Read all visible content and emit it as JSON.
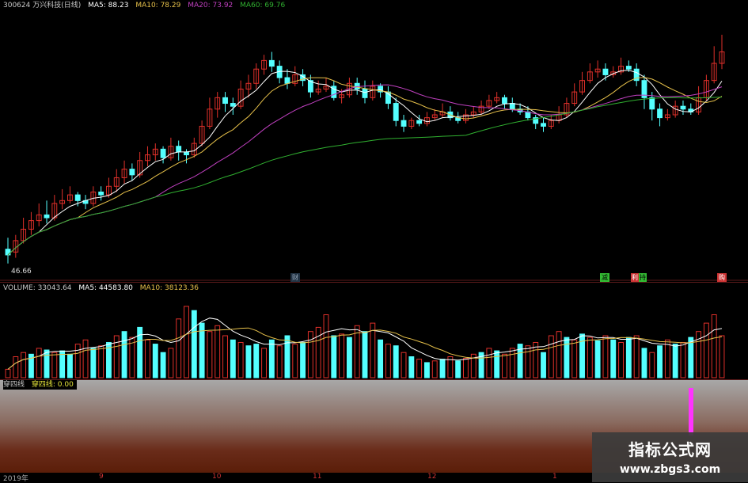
{
  "price_header": {
    "symbol": "300624 万兴科技(日线)",
    "ma5": "MA5: 88.23",
    "ma10": "MA10: 78.29",
    "ma20": "MA20: 73.92",
    "ma60": "MA60: 69.76"
  },
  "price_low_label": "46.66",
  "event_markers": [
    "财",
    "减",
    "利",
    "持",
    "购"
  ],
  "volume_header": {
    "volume": "VOLUME: 33043.64",
    "ma5": "MA5: 44583.80",
    "ma10": "MA10: 38123.36"
  },
  "indicator_header": {
    "name": "穿四线",
    "value": "穿四线: 0.00"
  },
  "time_axis": [
    "2019年",
    "9",
    "10",
    "11",
    "12",
    "1"
  ],
  "watermark": {
    "title": "指标公式网",
    "url": "www.zbgs3.com"
  },
  "colors": {
    "up": "#e0302a",
    "down": "#54ffff",
    "ma5": "#ffffff",
    "ma10": "#e6c04a",
    "ma20": "#c040c0",
    "ma60": "#30b030",
    "indicator_bar": "#ff33ff"
  },
  "candles": [
    [
      27,
      25,
      31,
      22
    ],
    [
      26,
      30,
      32,
      24
    ],
    [
      30,
      34,
      38,
      29
    ],
    [
      34,
      37,
      40,
      32
    ],
    [
      37,
      39,
      43,
      35
    ],
    [
      39,
      38,
      44,
      36
    ],
    [
      38,
      43,
      46,
      37
    ],
    [
      43,
      44,
      48,
      41
    ],
    [
      44,
      46,
      49,
      43
    ],
    [
      46,
      44,
      47,
      42
    ],
    [
      44,
      43,
      46,
      41
    ],
    [
      43,
      47,
      49,
      42
    ],
    [
      47,
      46,
      49,
      44
    ],
    [
      46,
      49,
      52,
      45
    ],
    [
      49,
      52,
      55,
      47
    ],
    [
      52,
      55,
      58,
      50
    ],
    [
      55,
      53,
      57,
      51
    ],
    [
      53,
      58,
      61,
      52
    ],
    [
      58,
      60,
      63,
      56
    ],
    [
      60,
      62,
      64,
      58
    ],
    [
      62,
      59,
      63,
      57
    ],
    [
      59,
      63,
      66,
      58
    ],
    [
      63,
      61,
      65,
      58
    ],
    [
      61,
      60,
      62,
      57
    ],
    [
      60,
      64,
      66,
      59
    ],
    [
      64,
      70,
      72,
      63
    ],
    [
      70,
      76,
      80,
      69
    ],
    [
      76,
      80,
      82,
      73
    ],
    [
      80,
      78,
      82,
      75
    ],
    [
      78,
      77,
      80,
      74
    ],
    [
      77,
      83,
      86,
      76
    ],
    [
      83,
      85,
      88,
      80
    ],
    [
      85,
      90,
      92,
      83
    ],
    [
      90,
      93,
      95,
      88
    ],
    [
      93,
      91,
      96,
      89
    ],
    [
      91,
      87,
      93,
      85
    ],
    [
      87,
      85,
      90,
      83
    ],
    [
      85,
      88,
      91,
      84
    ],
    [
      88,
      86,
      90,
      84
    ],
    [
      86,
      82,
      88,
      80
    ],
    [
      82,
      83,
      86,
      81
    ],
    [
      83,
      84,
      87,
      82
    ],
    [
      84,
      80,
      86,
      79
    ],
    [
      80,
      81,
      83,
      78
    ],
    [
      81,
      85,
      87,
      80
    ],
    [
      85,
      83,
      87,
      81
    ],
    [
      83,
      80,
      86,
      78
    ],
    [
      80,
      84,
      86,
      79
    ],
    [
      84,
      82,
      85,
      80
    ],
    [
      82,
      78,
      84,
      76
    ],
    [
      78,
      72,
      80,
      70
    ],
    [
      72,
      70,
      74,
      68
    ],
    [
      70,
      72,
      73,
      69
    ],
    [
      72,
      71,
      74,
      70
    ],
    [
      71,
      73,
      75,
      70
    ],
    [
      73,
      74,
      76,
      72
    ],
    [
      74,
      75,
      78,
      73
    ],
    [
      75,
      73,
      77,
      72
    ],
    [
      73,
      72,
      75,
      71
    ],
    [
      72,
      74,
      76,
      71
    ],
    [
      74,
      75,
      77,
      73
    ],
    [
      75,
      77,
      79,
      74
    ],
    [
      77,
      79,
      81,
      76
    ],
    [
      79,
      80,
      82,
      78
    ],
    [
      80,
      78,
      81,
      76
    ],
    [
      78,
      76,
      80,
      75
    ],
    [
      76,
      75,
      78,
      74
    ],
    [
      75,
      73,
      77,
      72
    ],
    [
      73,
      71,
      74,
      69
    ],
    [
      71,
      70,
      73,
      68
    ],
    [
      70,
      72,
      74,
      69
    ],
    [
      72,
      74,
      77,
      71
    ],
    [
      74,
      78,
      80,
      73
    ],
    [
      78,
      82,
      85,
      77
    ],
    [
      82,
      86,
      89,
      81
    ],
    [
      86,
      89,
      92,
      85
    ],
    [
      89,
      90,
      93,
      87
    ],
    [
      90,
      88,
      92,
      86
    ],
    [
      88,
      89,
      91,
      87
    ],
    [
      89,
      91,
      94,
      88
    ],
    [
      91,
      90,
      93,
      89
    ],
    [
      90,
      86,
      92,
      84
    ],
    [
      86,
      80,
      88,
      76
    ],
    [
      80,
      76,
      82,
      72
    ],
    [
      76,
      73,
      78,
      70
    ],
    [
      73,
      74,
      76,
      72
    ],
    [
      74,
      77,
      79,
      73
    ],
    [
      77,
      76,
      79,
      74
    ],
    [
      76,
      75,
      78,
      74
    ],
    [
      75,
      80,
      84,
      74
    ],
    [
      80,
      86,
      88,
      79
    ],
    [
      86,
      92,
      98,
      85
    ],
    [
      92,
      96,
      102,
      90
    ]
  ],
  "volumes": [
    [
      0.1,
      1
    ],
    [
      0.25,
      1
    ],
    [
      0.3,
      1
    ],
    [
      0.28,
      0
    ],
    [
      0.35,
      1
    ],
    [
      0.33,
      0
    ],
    [
      0.3,
      1
    ],
    [
      0.32,
      0
    ],
    [
      0.28,
      0
    ],
    [
      0.4,
      1
    ],
    [
      0.45,
      1
    ],
    [
      0.35,
      0
    ],
    [
      0.38,
      1
    ],
    [
      0.42,
      0
    ],
    [
      0.5,
      1
    ],
    [
      0.55,
      0
    ],
    [
      0.48,
      1
    ],
    [
      0.6,
      0
    ],
    [
      0.45,
      1
    ],
    [
      0.4,
      0
    ],
    [
      0.3,
      0
    ],
    [
      0.35,
      1
    ],
    [
      0.7,
      1
    ],
    [
      0.85,
      1
    ],
    [
      0.8,
      0
    ],
    [
      0.65,
      0
    ],
    [
      0.55,
      1
    ],
    [
      0.62,
      1
    ],
    [
      0.5,
      1
    ],
    [
      0.45,
      0
    ],
    [
      0.42,
      1
    ],
    [
      0.38,
      0
    ],
    [
      0.4,
      0
    ],
    [
      0.35,
      1
    ],
    [
      0.45,
      0
    ],
    [
      0.38,
      1
    ],
    [
      0.5,
      0
    ],
    [
      0.4,
      1
    ],
    [
      0.42,
      0
    ],
    [
      0.55,
      1
    ],
    [
      0.6,
      1
    ],
    [
      0.75,
      1
    ],
    [
      0.5,
      0
    ],
    [
      0.52,
      1
    ],
    [
      0.48,
      0
    ],
    [
      0.62,
      1
    ],
    [
      0.55,
      0
    ],
    [
      0.65,
      1
    ],
    [
      0.45,
      0
    ],
    [
      0.4,
      1
    ],
    [
      0.38,
      0
    ],
    [
      0.3,
      1
    ],
    [
      0.25,
      0
    ],
    [
      0.22,
      1
    ],
    [
      0.18,
      0
    ],
    [
      0.2,
      1
    ],
    [
      0.22,
      0
    ],
    [
      0.25,
      1
    ],
    [
      0.2,
      0
    ],
    [
      0.23,
      1
    ],
    [
      0.28,
      1
    ],
    [
      0.3,
      0
    ],
    [
      0.35,
      1
    ],
    [
      0.32,
      0
    ],
    [
      0.28,
      1
    ],
    [
      0.35,
      1
    ],
    [
      0.4,
      0
    ],
    [
      0.38,
      1
    ],
    [
      0.42,
      1
    ],
    [
      0.3,
      0
    ],
    [
      0.5,
      1
    ],
    [
      0.55,
      1
    ],
    [
      0.48,
      0
    ],
    [
      0.45,
      1
    ],
    [
      0.52,
      0
    ],
    [
      0.48,
      1
    ],
    [
      0.44,
      0
    ],
    [
      0.5,
      1
    ],
    [
      0.45,
      0
    ],
    [
      0.42,
      1
    ],
    [
      0.48,
      0
    ],
    [
      0.5,
      1
    ],
    [
      0.35,
      0
    ],
    [
      0.3,
      1
    ],
    [
      0.38,
      0
    ],
    [
      0.45,
      1
    ],
    [
      0.4,
      0
    ],
    [
      0.42,
      1
    ],
    [
      0.48,
      0
    ],
    [
      0.55,
      1
    ],
    [
      0.65,
      1
    ],
    [
      0.75,
      1
    ],
    [
      0.5,
      1
    ]
  ],
  "indicator_signal_index": 88
}
